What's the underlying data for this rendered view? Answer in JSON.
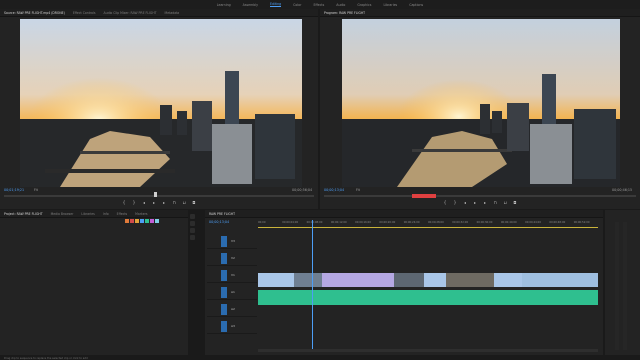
{
  "workspaces": [
    "Learning",
    "Assembly",
    "Editing",
    "Color",
    "Effects",
    "Audio",
    "Graphics",
    "Libraries",
    "Captions"
  ],
  "source_monitor": {
    "tabs": [
      "Source: RAW PRE FLIGHT.mp4 (DRONE)",
      "Effect Controls",
      "Audio Clip Mixer: RAW PRE FLIGHT",
      "Metadata"
    ],
    "timecode_left": "00;01;19;21",
    "fit": "Fit",
    "timecode_right": "00;00;56;04"
  },
  "program_monitor": {
    "tabs": [
      "Program: RAW PRE FLIGHT"
    ],
    "timecode_left": "00;00;13;04",
    "fit": "Fit",
    "timecode_right": "00;00;46;15"
  },
  "project_panel": {
    "tabs": [
      "Project: RAW PRE FLIGHT",
      "Media Browser",
      "Libraries",
      "Info",
      "Effects",
      "Markers",
      "History"
    ],
    "status": "Drag clip to sequence to replace the selected clip or click to add"
  },
  "timeline": {
    "tab": "RAW PRE FLIGHT",
    "timecode": "00;00;13;04",
    "ruler": [
      "00;00",
      "00;00;04;00",
      "00;00;08;00",
      "00;00;12;00",
      "00;00;16;00",
      "00;00;20;00",
      "00;00;24;00",
      "00;00;28;00",
      "00;00;32;00",
      "00;00;36;00",
      "00;00;40;00",
      "00;00;44;00",
      "00;00;48;00",
      "00;00;52;00"
    ],
    "tracks": [
      "V3",
      "V2",
      "V1",
      "A1",
      "A2",
      "A3"
    ],
    "playhead_fraction": 0.16
  },
  "colors": {
    "accent": "#4d9ef5",
    "video_clip": "#9b95d9",
    "video_clip_light": "#a9c6e8",
    "audio_clip": "#2fbf8f",
    "record": "#e04040"
  }
}
